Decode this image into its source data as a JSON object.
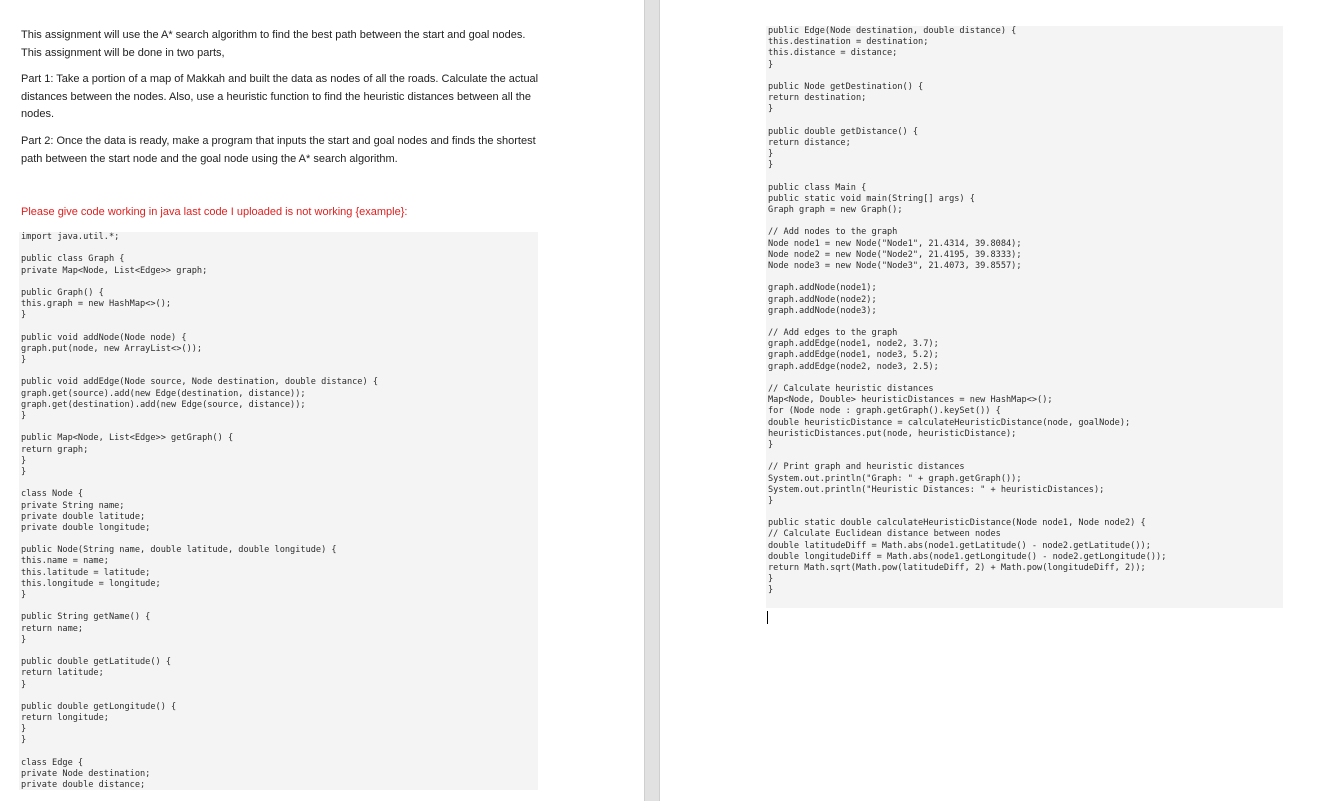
{
  "paragraphs": {
    "p1": "This assignment will use the A* search algorithm to find the best path between the start and goal nodes. This assignment will be done in two parts,",
    "p2": "Part 1: Take a portion of a map of Makkah and built the data as nodes of all the roads. Calculate the actual distances between the nodes. Also, use a heuristic function to find the heuristic distances between all the nodes.",
    "p3": "Part 2: Once the data is ready, make a program that inputs the start and goal nodes and finds the shortest path between the start node and the goal node using the A* search algorithm.",
    "p4": "Please give code working in java last code I uploaded is not working {example}:"
  },
  "colors": {
    "red_text": "#e02020",
    "code_bg": "#f4f4f4"
  },
  "code_left": [
    "import java.util.*;",
    "",
    "public class Graph {",
    "private Map<Node, List<Edge>> graph;",
    "",
    "public Graph() {",
    "this.graph = new HashMap<>();",
    "}",
    "",
    "public void addNode(Node node) {",
    "graph.put(node, new ArrayList<>());",
    "}",
    "",
    "public void addEdge(Node source, Node destination, double distance) {",
    "graph.get(source).add(new Edge(destination, distance));",
    "graph.get(destination).add(new Edge(source, distance));",
    "}",
    "",
    "public Map<Node, List<Edge>> getGraph() {",
    "return graph;",
    "}",
    "}",
    "",
    "class Node {",
    "private String name;",
    "private double latitude;",
    "private double longitude;",
    "",
    "public Node(String name, double latitude, double longitude) {",
    "this.name = name;",
    "this.latitude = latitude;",
    "this.longitude = longitude;",
    "}",
    "",
    "public String getName() {",
    "return name;",
    "}",
    "",
    "public double getLatitude() {",
    "return latitude;",
    "}",
    "",
    "public double getLongitude() {",
    "return longitude;",
    "}",
    "}",
    "",
    "class Edge {",
    "private Node destination;",
    "private double distance;"
  ],
  "code_right": [
    "public Edge(Node destination, double distance) {",
    "this.destination = destination;",
    "this.distance = distance;",
    "}",
    "",
    "public Node getDestination() {",
    "return destination;",
    "}",
    "",
    "public double getDistance() {",
    "return distance;",
    "}",
    "}",
    "",
    "public class Main {",
    "public static void main(String[] args) {",
    "Graph graph = new Graph();",
    "",
    "// Add nodes to the graph",
    "Node node1 = new Node(\"Node1\", 21.4314, 39.8084);",
    "Node node2 = new Node(\"Node2\", 21.4195, 39.8333);",
    "Node node3 = new Node(\"Node3\", 21.4073, 39.8557);",
    "",
    "graph.addNode(node1);",
    "graph.addNode(node2);",
    "graph.addNode(node3);",
    "",
    "// Add edges to the graph",
    "graph.addEdge(node1, node2, 3.7);",
    "graph.addEdge(node1, node3, 5.2);",
    "graph.addEdge(node2, node3, 2.5);",
    "",
    "// Calculate heuristic distances",
    "Map<Node, Double> heuristicDistances = new HashMap<>();",
    "for (Node node : graph.getGraph().keySet()) {",
    "double heuristicDistance = calculateHeuristicDistance(node, goalNode);",
    "heuristicDistances.put(node, heuristicDistance);",
    "}",
    "",
    "// Print graph and heuristic distances",
    "System.out.println(\"Graph: \" + graph.getGraph());",
    "System.out.println(\"Heuristic Distances: \" + heuristicDistances);",
    "}",
    "",
    "public static double calculateHeuristicDistance(Node node1, Node node2) {",
    "// Calculate Euclidean distance between nodes",
    "double latitudeDiff = Math.abs(node1.getLatitude() - node2.getLatitude());",
    "double longitudeDiff = Math.abs(node1.getLongitude() - node2.getLongitude());",
    "return Math.sqrt(Math.pow(latitudeDiff, 2) + Math.pow(longitudeDiff, 2));",
    "}",
    "}"
  ]
}
